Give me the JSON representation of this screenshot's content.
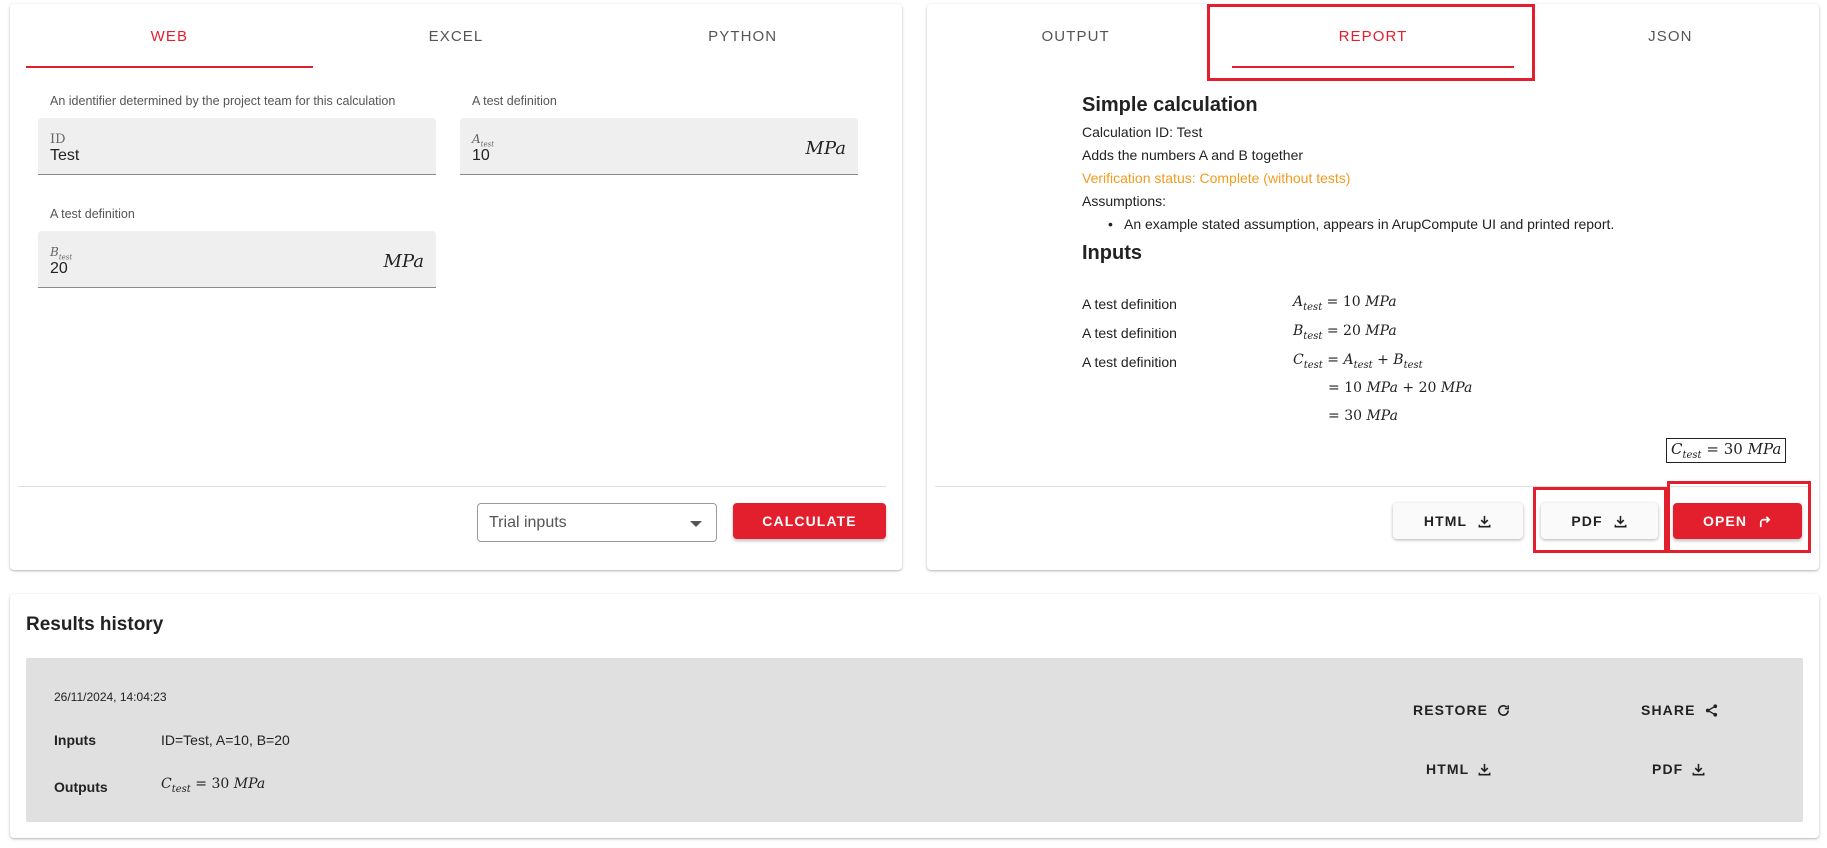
{
  "left": {
    "tabs": [
      "WEB",
      "EXCEL",
      "PYTHON"
    ],
    "active_tab": "WEB",
    "fields": {
      "id": {
        "label": "An identifier determined by the project team for this calculation",
        "symbol": "ID",
        "value": "Test"
      },
      "a": {
        "label": "A test definition",
        "symbol_main": "A",
        "symbol_sub": "test",
        "value": "10",
        "unit": "MPa"
      },
      "b": {
        "label": "A test definition",
        "symbol_main": "B",
        "symbol_sub": "test",
        "value": "20",
        "unit": "MPa"
      }
    },
    "trial_select": "Trial inputs",
    "calculate_label": "CALCULATE"
  },
  "right": {
    "tabs": [
      "OUTPUT",
      "REPORT",
      "JSON"
    ],
    "active_tab": "REPORT",
    "report": {
      "title": "Simple calculation",
      "calc_id": "Calculation ID: Test",
      "description": "Adds the numbers A and B together",
      "status": "Verification status: Complete (without tests)",
      "assumptions_heading": "Assumptions:",
      "assumption": "An example stated assumption, appears in ArupCompute UI and printed report.",
      "inputs_heading": "Inputs",
      "rows": [
        {
          "label": "A test definition",
          "lhs": "A",
          "sub": "test",
          "rhs": "= 10 MPa"
        },
        {
          "label": "A test definition",
          "lhs": "B",
          "sub": "test",
          "rhs": "= 20 MPa"
        },
        {
          "label": "A test definition",
          "lhs": "C",
          "sub": "test",
          "rhs": "= A_test + B_test"
        }
      ],
      "step2": "= 10 MPa + 20 MPa",
      "step3": "= 30 MPa",
      "result": "C_test = 30 MPa"
    },
    "buttons": {
      "html": "HTML",
      "pdf": "PDF",
      "open": "OPEN"
    }
  },
  "history": {
    "title": "Results history",
    "date": "26/11/2024, 14:04:23",
    "inputs_key": "Inputs",
    "inputs_val": "ID=Test, A=10, B=20",
    "outputs_key": "Outputs",
    "outputs_val": "C_test = 30 MPa",
    "buttons": {
      "restore": "RESTORE",
      "share": "SHARE",
      "html": "HTML",
      "pdf": "PDF"
    }
  },
  "colors": {
    "accent": "#e31e2d",
    "status": "#f29b1f",
    "history_bg": "#e0e0e0"
  },
  "icons": [
    "download-icon",
    "open-external-icon",
    "refresh-icon",
    "share-icon",
    "dropdown-caret-icon"
  ]
}
